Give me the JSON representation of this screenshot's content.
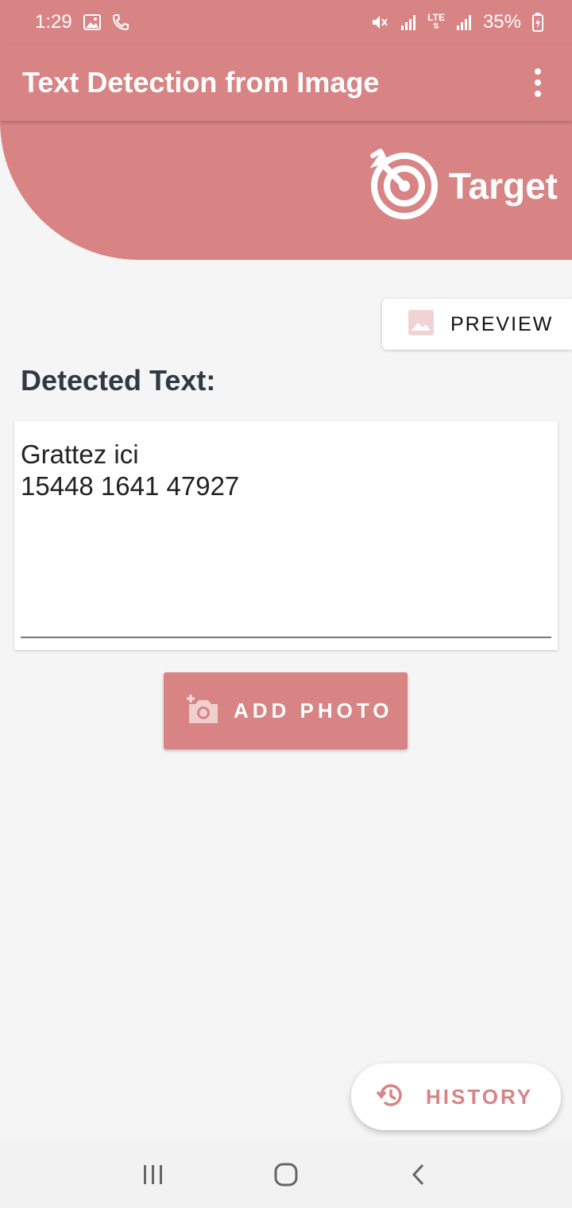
{
  "colors": {
    "accent": "#d88384",
    "background": "#f5f5f5",
    "label_dark": "#2f3a45"
  },
  "status_bar": {
    "time": "1:29",
    "battery": "35%",
    "network_label": "LTE",
    "icons": [
      "gallery-icon",
      "call-icon",
      "mute-icon",
      "signal-icon",
      "lte-icon",
      "signal-icon",
      "battery-charging-icon"
    ]
  },
  "app_bar": {
    "title": "Text Detection from Image",
    "menu_icon": "more-vert-icon"
  },
  "brand": {
    "name": "Target",
    "icon": "target-icon"
  },
  "preview_button": {
    "label": "PREVIEW",
    "icon": "image-icon"
  },
  "detected": {
    "label": "Detected Text:",
    "text": "Grattez ici\n15448 1641 47927"
  },
  "add_photo_button": {
    "label": "ADD PHOTO",
    "icon": "add-camera-icon"
  },
  "history_button": {
    "label": "HISTORY",
    "icon": "history-icon"
  },
  "nav_bar": {
    "items": [
      "recents-icon",
      "home-icon",
      "back-icon"
    ]
  }
}
